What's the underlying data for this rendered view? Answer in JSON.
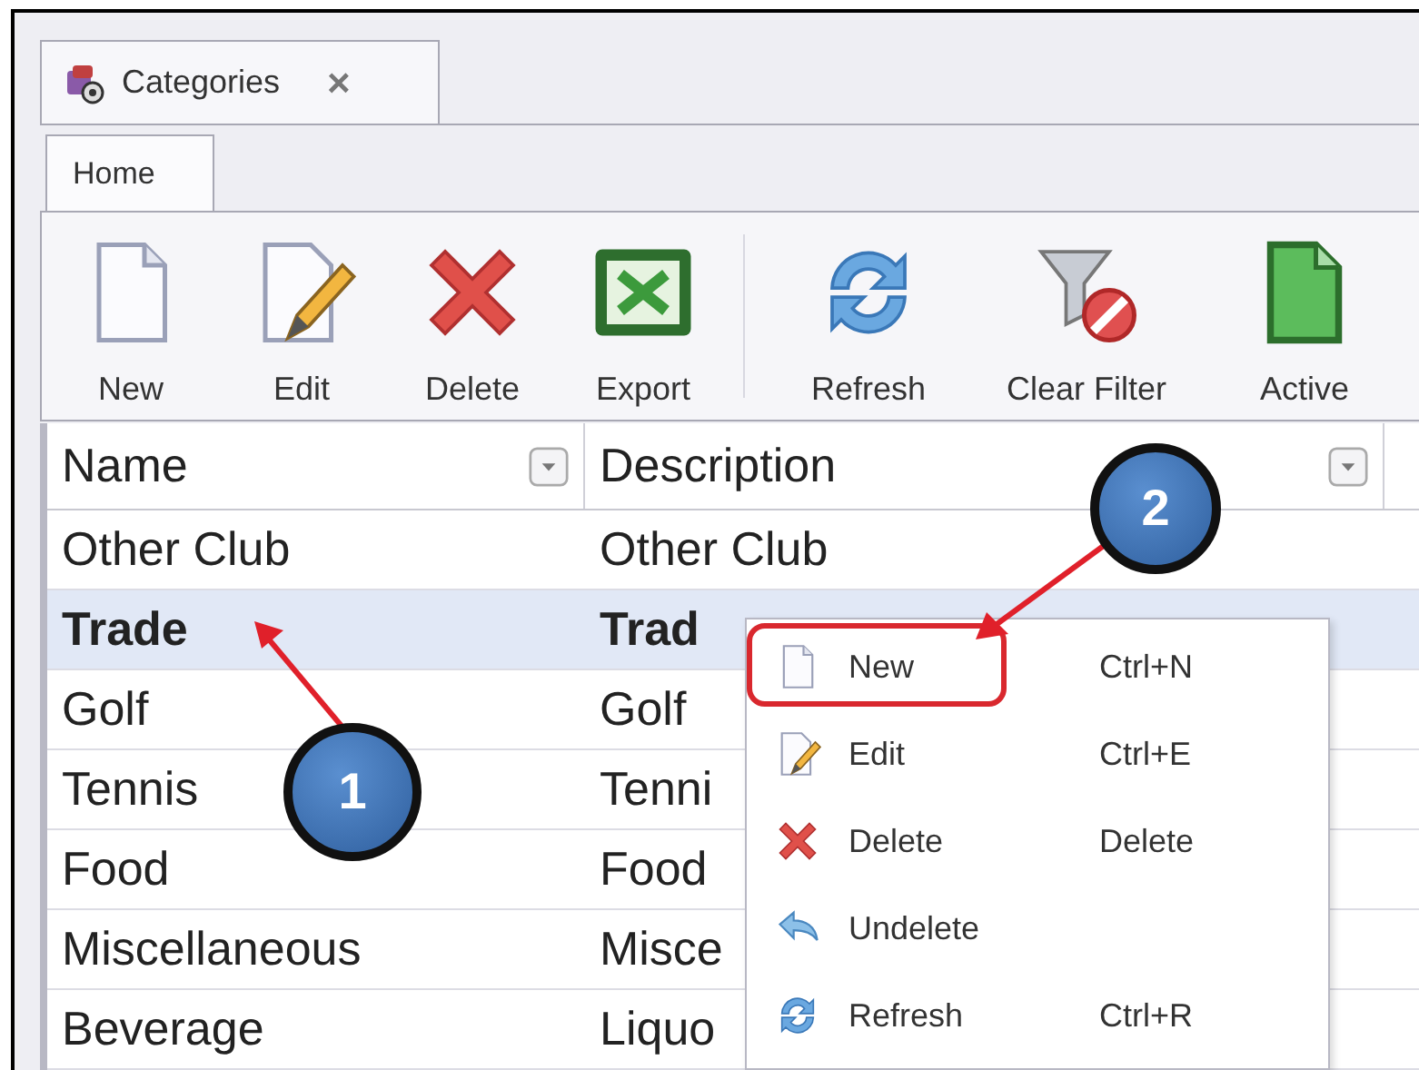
{
  "doc_tab": {
    "title": "Categories",
    "close": "×"
  },
  "ribbon_tabs": [
    {
      "label": "Home",
      "selected": true
    }
  ],
  "toolbar": {
    "groups": [
      [
        {
          "kind": "new",
          "label": "New"
        },
        {
          "kind": "edit",
          "label": "Edit"
        },
        {
          "kind": "delete",
          "label": "Delete"
        },
        {
          "kind": "export",
          "label": "Export"
        }
      ],
      [
        {
          "kind": "refresh",
          "label": "Refresh"
        },
        {
          "kind": "clear-filter",
          "label": "Clear Filter"
        },
        {
          "kind": "active",
          "label": "Active"
        }
      ]
    ]
  },
  "grid": {
    "columns": [
      "Name",
      "Description"
    ],
    "rows": [
      {
        "name": "Other Club",
        "description": "Other Club",
        "selected": false
      },
      {
        "name": "Trade",
        "description": "Trad",
        "selected": true
      },
      {
        "name": "Golf",
        "description": "Golf",
        "selected": false
      },
      {
        "name": "Tennis",
        "description": "Tenni",
        "selected": false
      },
      {
        "name": "Food",
        "description": "Food",
        "selected": false
      },
      {
        "name": "Miscellaneous",
        "description": "Misce",
        "selected": false
      },
      {
        "name": "Beverage",
        "description": "Liquo",
        "selected": false
      }
    ]
  },
  "context_menu": [
    {
      "kind": "new",
      "label": "New",
      "shortcut": "Ctrl+N",
      "callout": true
    },
    {
      "kind": "edit",
      "label": "Edit",
      "shortcut": "Ctrl+E",
      "callout": false
    },
    {
      "kind": "delete",
      "label": "Delete",
      "shortcut": "Delete",
      "callout": false
    },
    {
      "kind": "undelete",
      "label": "Undelete",
      "callout": false
    },
    {
      "kind": "refresh",
      "label": "Refresh",
      "shortcut": "Ctrl+R",
      "callout": false
    }
  ],
  "annotations": [
    {
      "number": "1"
    },
    {
      "number": "2"
    }
  ]
}
